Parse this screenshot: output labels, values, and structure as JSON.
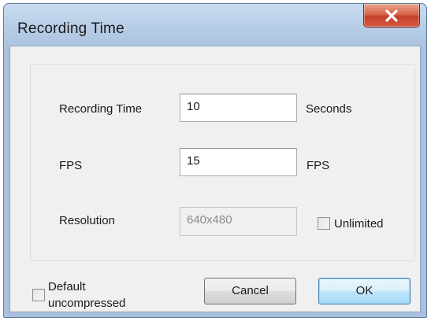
{
  "window": {
    "title": "Recording Time",
    "close_icon": "close-x-icon"
  },
  "fields": {
    "recording_time": {
      "label": "Recording Time",
      "value": "10",
      "unit": "Seconds"
    },
    "fps": {
      "label": "FPS",
      "value": "15",
      "unit": "FPS"
    },
    "resolution": {
      "label": "Resolution",
      "value": "640x480",
      "enabled": false
    }
  },
  "options": {
    "unlimited_label": "Unlimited",
    "unlimited_checked": false,
    "default_uncompressed_line1": "Default",
    "default_uncompressed_line2": "uncompressed",
    "default_uncompressed_checked": false
  },
  "buttons": {
    "cancel_label": "Cancel",
    "ok_label": "OK"
  },
  "colors": {
    "title_bar": "#b7cde6",
    "close_button": "#c4402a",
    "default_button": "#bee6fd"
  }
}
